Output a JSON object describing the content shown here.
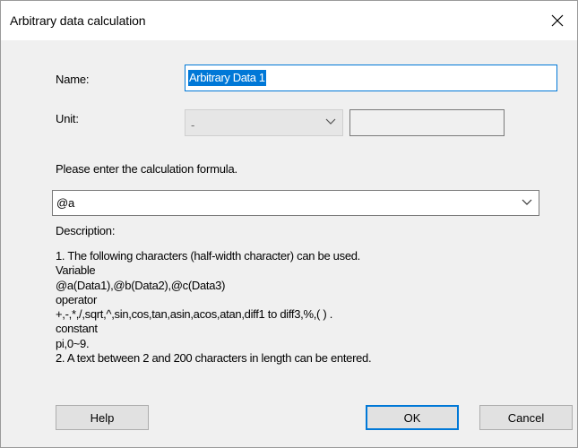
{
  "window": {
    "title": "Arbitrary data calculation"
  },
  "form": {
    "name_label": "Name:",
    "name_value": "Arbitrary Data 1",
    "unit_label": "Unit:",
    "unit_selected": "-",
    "unit_text_value": "",
    "formula_prompt": "Please enter the calculation formula.",
    "formula_value": "@a"
  },
  "description": {
    "heading": "Description:",
    "lines": [
      "1. The following characters (half-width character) can be used.",
      "Variable",
      "@a(Data1),@b(Data2),@c(Data3)",
      "operator",
      "+,-,*,/,sqrt,^,sin,cos,tan,asin,acos,atan,diff1 to diff3,%,( ) .",
      "constant",
      "pi,0~9.",
      "2. A text between 2 and 200 characters in length can be entered."
    ]
  },
  "buttons": {
    "help": "Help",
    "ok": "OK",
    "cancel": "Cancel"
  },
  "icons": {
    "close": "close-icon",
    "dropdown": "chevron-down-icon"
  },
  "colors": {
    "accent": "#0078d7",
    "dialog_bg": "#f0f0f0",
    "titlebar_bg": "#ffffff",
    "button_bg": "#e1e1e1"
  }
}
